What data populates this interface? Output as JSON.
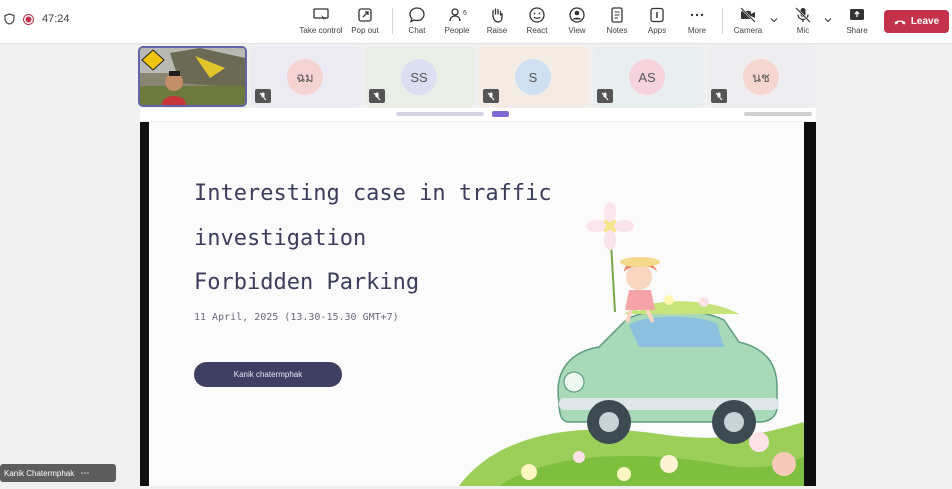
{
  "toolbar": {
    "timer": "47:24",
    "buttons": {
      "take_control": "Take control",
      "pop_out": "Pop out",
      "chat": "Chat",
      "people": "People",
      "people_count": "6",
      "raise": "Raise",
      "react": "React",
      "view": "View",
      "notes": "Notes",
      "apps": "Apps",
      "more": "More",
      "camera": "Camera",
      "mic": "Mic",
      "share": "Share",
      "leave": "Leave"
    }
  },
  "participants": [
    {
      "initials": "",
      "video": true,
      "avatar_color": "#d9d9d9"
    },
    {
      "initials": "ฉม",
      "avatar_color": "#f6d3d3",
      "tile_color": "#ecebf3"
    },
    {
      "initials": "SS",
      "avatar_color": "#dcdff2",
      "tile_color": "#e9eee6"
    },
    {
      "initials": "S",
      "avatar_color": "#cfe0f2",
      "tile_color": "#f4ece2"
    },
    {
      "initials": "AS",
      "avatar_color": "#f6d3dc",
      "tile_color": "#e9eff0"
    },
    {
      "initials": "นช",
      "avatar_color": "#f6d6d0",
      "tile_color": "#eeeef1"
    }
  ],
  "slide": {
    "title_line1": "Interesting case in traffic",
    "title_line2": "investigation",
    "title_line3": "Forbidden Parking",
    "date": "11 April, 2025 (13.30-15.30 GMT+7)",
    "presenter": "Kanik chatermphak"
  },
  "presenter_tag": {
    "name": "Kanik Chatermphak"
  },
  "colors": {
    "leave": "#c4314b",
    "active_tile_border": "#6264a7",
    "slide_title": "#3c3c5c",
    "pill": "#3f3e63"
  }
}
